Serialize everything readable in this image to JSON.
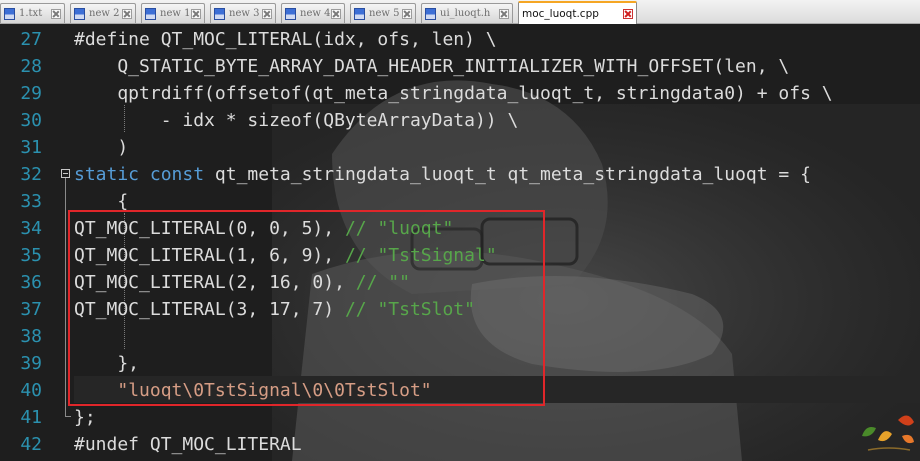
{
  "tabs": [
    {
      "label": "1.txt",
      "active": false
    },
    {
      "label": "new 2",
      "active": false
    },
    {
      "label": "new 1",
      "active": false
    },
    {
      "label": "new 3",
      "active": false
    },
    {
      "label": "new 4",
      "active": false
    },
    {
      "label": "new 5",
      "active": false
    },
    {
      "label": "ui_luoqt.h",
      "active": false
    },
    {
      "label": "moc_luoqt.cpp",
      "active": true
    }
  ],
  "editor": {
    "line_numbers": [
      "27",
      "28",
      "29",
      "30",
      "31",
      "32",
      "33",
      "34",
      "35",
      "36",
      "37",
      "38",
      "39",
      "40",
      "41",
      "42"
    ],
    "lines": [
      [
        {
          "t": "#define QT_MOC_LITERAL(idx, ofs, len) \\",
          "c": "pp"
        }
      ],
      [
        {
          "t": "    Q_STATIC_BYTE_ARRAY_DATA_HEADER_INITIALIZER_WITH_OFFSET(len, \\",
          "c": "pp"
        }
      ],
      [
        {
          "t": "    qptrdiff(offsetof(qt_meta_stringdata_luoqt_t, stringdata0) + ofs \\",
          "c": "pp"
        }
      ],
      [
        {
          "t": "        - idx * sizeof(QByteArrayData)) \\",
          "c": "pp"
        }
      ],
      [
        {
          "t": "    )",
          "c": "pp"
        }
      ],
      [
        {
          "t": "static",
          "c": "kw"
        },
        {
          "t": " ",
          "c": "pp"
        },
        {
          "t": "const",
          "c": "kw"
        },
        {
          "t": " qt_meta_stringdata_luoqt_t qt_meta_stringdata_luoqt = {",
          "c": "pp"
        }
      ],
      [
        {
          "t": "    {",
          "c": "pp"
        }
      ],
      [
        {
          "t": "QT_MOC_LITERAL(0, 0, 5), ",
          "c": "pp"
        },
        {
          "t": "// \"luoqt\"",
          "c": "cm"
        }
      ],
      [
        {
          "t": "QT_MOC_LITERAL(1, 6, 9), ",
          "c": "pp"
        },
        {
          "t": "// \"TstSignal\"",
          "c": "cm"
        }
      ],
      [
        {
          "t": "QT_MOC_LITERAL(2, 16, 0), ",
          "c": "pp"
        },
        {
          "t": "// \"\"",
          "c": "cm"
        }
      ],
      [
        {
          "t": "QT_MOC_LITERAL(3, 17, 7) ",
          "c": "pp"
        },
        {
          "t": "// \"TstSlot\"",
          "c": "cm"
        }
      ],
      [
        {
          "t": "",
          "c": "pp"
        }
      ],
      [
        {
          "t": "    },",
          "c": "pp"
        }
      ],
      [
        {
          "t": "    ",
          "c": "pp"
        },
        {
          "t": "\"luoqt\\0TstSignal\\0\\0TstSlot\"",
          "c": "str"
        }
      ],
      [
        {
          "t": "};",
          "c": "pp"
        }
      ],
      [
        {
          "t": "#undef QT_MOC_LITERAL",
          "c": "pp"
        }
      ]
    ]
  },
  "colors": {
    "background": "#1e1e1e",
    "line_number": "#2b91af",
    "keyword": "#569cd6",
    "comment": "#57a64a",
    "string": "#d69d85",
    "text": "#dcdcdc",
    "highlight_box": "#e0262a",
    "active_tab_accent": "#f5a623"
  }
}
